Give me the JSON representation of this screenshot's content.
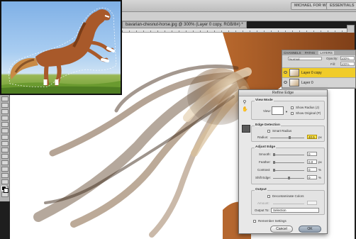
{
  "app": {
    "workspace_label": "MICHAEL FOR WEB",
    "essentials_label": "ESSENTIALS"
  },
  "document": {
    "tab_title": "bavarian-chesnut-horse.jpg @ 300% (Layer 0 copy, RGB/8#) *"
  },
  "layers_panel": {
    "tabs": [
      "CHANNELS",
      "PATHS",
      "LAYERS"
    ],
    "blend_mode": "Normal",
    "opacity_label": "Opacity:",
    "opacity_value": "100%",
    "fill_label": "Fill:",
    "fill_value": "100%",
    "layers": [
      {
        "name": "Layer 0 copy",
        "active": true
      },
      {
        "name": "Layer 0",
        "active": false
      }
    ]
  },
  "refine_edge": {
    "title": "Refine Edge",
    "view_mode": {
      "title": "View Mode",
      "view_label": "View:",
      "show_radius_label": "Show Radius (J)",
      "show_original_label": "Show Original (P)"
    },
    "edge_detection": {
      "title": "Edge Detection",
      "smart_radius_label": "Smart Radius",
      "radius_label": "Radius:",
      "radius_value": "40.5",
      "radius_unit": "px"
    },
    "adjust_edge": {
      "title": "Adjust Edge",
      "smooth_label": "Smooth:",
      "smooth_value": "0",
      "feather_label": "Feather:",
      "feather_value": "0.0",
      "feather_unit": "px",
      "contrast_label": "Contrast:",
      "contrast_value": "0",
      "contrast_unit": "%",
      "shift_label": "Shift Edge:",
      "shift_value": "0",
      "shift_unit": "%"
    },
    "output": {
      "title": "Output",
      "decontaminate_label": "Decontaminate Colors",
      "amount_label": "Amount:",
      "output_to_label": "Output To:",
      "output_to_value": "Selection"
    },
    "remember_label": "Remember Settings",
    "cancel_label": "Cancel",
    "ok_label": "OK"
  },
  "colors": {
    "active_layer": "#f0cc2a",
    "radius_field": "#ffe64d",
    "horse_coat": "#a8592a",
    "sky": "#7fb0e6",
    "grass": "#6a9a2f"
  }
}
